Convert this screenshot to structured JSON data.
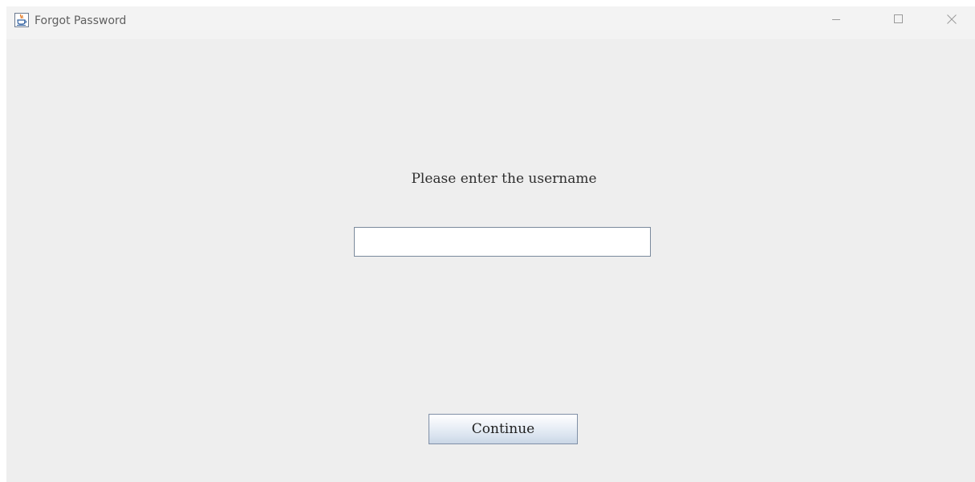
{
  "window": {
    "title": "Forgot Password",
    "icon": "java-cup-icon",
    "controls": {
      "minimize_icon": "minimize-icon",
      "maximize_icon": "maximize-icon",
      "close_icon": "close-icon"
    }
  },
  "form": {
    "prompt": "Please enter the username",
    "username_value": "",
    "continue_label": "Continue"
  },
  "colors": {
    "background": "#eeeeee",
    "titlebar": "#f3f3f3",
    "button_border": "#7f8fa6",
    "field_border": "#7a8a9c"
  }
}
